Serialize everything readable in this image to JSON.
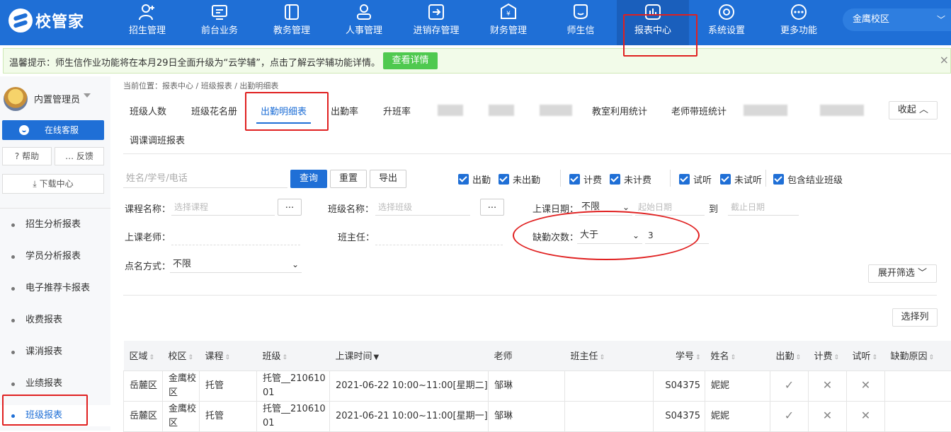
{
  "logo": {
    "text": "校管家"
  },
  "topnav": {
    "items": [
      {
        "label": "招生管理",
        "icon": "user-add-icon"
      },
      {
        "label": "前台业务",
        "icon": "monitor-icon"
      },
      {
        "label": "教务管理",
        "icon": "book-icon"
      },
      {
        "label": "人事管理",
        "icon": "person-icon"
      },
      {
        "label": "进销存管理",
        "icon": "inventory-icon"
      },
      {
        "label": "财务管理",
        "icon": "finance-icon"
      },
      {
        "label": "师生信",
        "icon": "chat-icon"
      },
      {
        "label": "报表中心",
        "icon": "report-icon"
      },
      {
        "label": "系统设置",
        "icon": "settings-icon"
      },
      {
        "label": "更多功能",
        "icon": "more-icon"
      }
    ],
    "active": "报表中心",
    "campus": "金鹰校区"
  },
  "notice": {
    "text": "温馨提示：师生信作业功能将在本月29日全面升级为“云学辅”，点击了解云学辅功能详情。",
    "button": "查看详情",
    "close": "×"
  },
  "sidebar": {
    "admin_name": "内置管理员",
    "customer_service": "在线客服",
    "help": "帮助",
    "feedback": "反馈",
    "download": "下载中心",
    "items": [
      "招生分析报表",
      "学员分析报表",
      "电子推荐卡报表",
      "收费报表",
      "课消报表",
      "业绩报表",
      "班级报表"
    ],
    "active": "班级报表"
  },
  "breadcrumb": "当前位置：报表中心 / 班级报表 / 出勤明细表",
  "tabs": {
    "items": [
      "班级人数",
      "班级花名册",
      "出勤明细表",
      "出勤率",
      "升班率",
      "教室利用统计",
      "老师带班统计",
      "调课调班报表"
    ],
    "active": "出勤明细表",
    "collapse": "收起 ︿"
  },
  "search": {
    "placeholder": "姓名/学号/电话",
    "query": "查询",
    "reset": "重置",
    "export": "导出"
  },
  "checkboxes": [
    "出勤",
    "未出勤",
    "计费",
    "未计费",
    "试听",
    "未试听",
    "包含结业班级"
  ],
  "filters": {
    "course_label": "课程名称：",
    "course_placeholder": "选择课程",
    "class_label": "班级名称：",
    "class_placeholder": "选择班级",
    "date_label": "上课日期：",
    "date_mode": "不限",
    "start_placeholder": "起始日期",
    "to": "到",
    "end_placeholder": "截止日期",
    "teacher_label": "上课老师：",
    "head_label": "班主任：",
    "absence_label": "缺勤次数：",
    "absence_op": "大于",
    "absence_value": "3",
    "rollcall_label": "点名方式：",
    "rollcall_value": "不限",
    "dots": "...",
    "expand": "展开筛选 ﹀",
    "select_cols": "选择列"
  },
  "table": {
    "headers": [
      "区域",
      "校区",
      "课程",
      "班级",
      "上课时间",
      "老师",
      "班主任",
      "学号",
      "姓名",
      "出勤",
      "计费",
      "试听",
      "缺勤原因"
    ],
    "rows": [
      {
        "area": "岳麓区",
        "campus": "金鹰校区",
        "course": "托管",
        "class": "托管__21061001",
        "time": "2021-06-22 10:00~11:00[星期二]",
        "teacher": "邹琳",
        "head": "",
        "id": "S04375",
        "name": "妮妮",
        "attend": "✓",
        "bill": "✕",
        "trial": "✕",
        "reason": ""
      },
      {
        "area": "岳麓区",
        "campus": "金鹰校区",
        "course": "托管",
        "class": "托管__21061001",
        "time": "2021-06-21 10:00~11:00[星期一]",
        "teacher": "邹琳",
        "head": "",
        "id": "S04375",
        "name": "妮妮",
        "attend": "✓",
        "bill": "✕",
        "trial": "✕",
        "reason": ""
      }
    ]
  },
  "colors": {
    "brand": "#1f6fd6",
    "notice_button": "#4fc94f",
    "annotation": "#e02020"
  }
}
